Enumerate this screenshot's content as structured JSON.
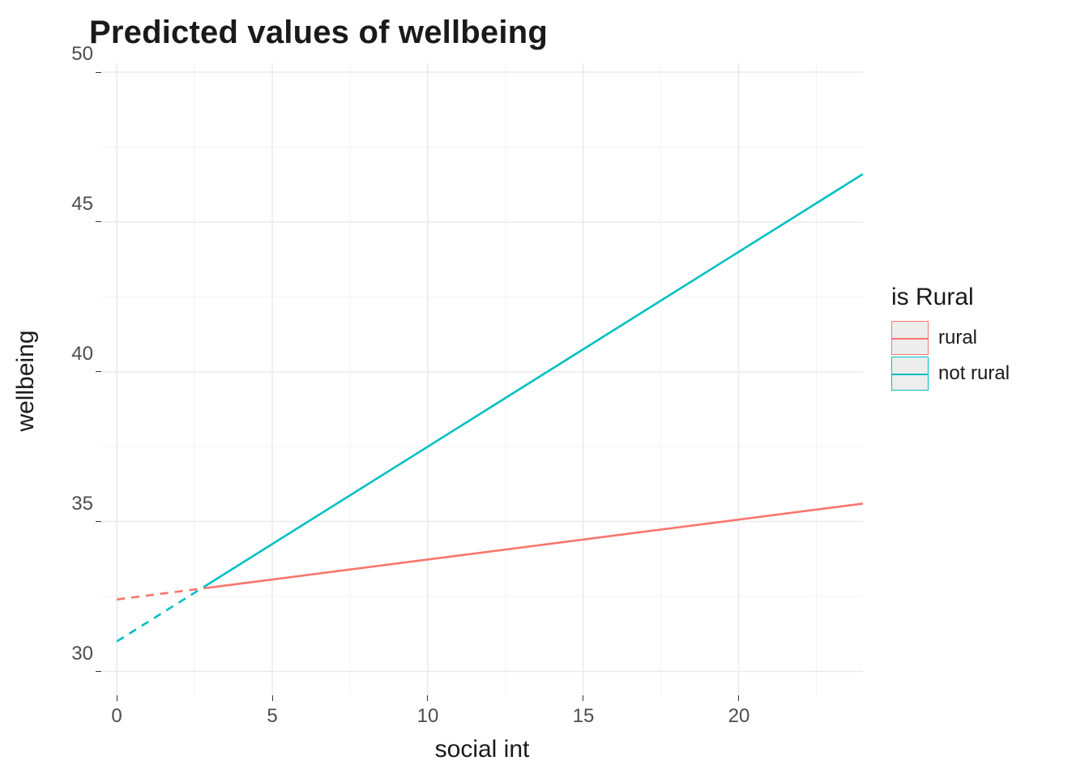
{
  "chart_data": {
    "type": "line",
    "title": "Predicted values of wellbeing",
    "xlabel": "social int",
    "ylabel": "wellbeing",
    "xlim": [
      -0.5,
      24.0
    ],
    "ylim": [
      29.2,
      50.3
    ],
    "x_ticks": [
      0,
      5,
      10,
      15,
      20
    ],
    "y_ticks": [
      30,
      35,
      40,
      45,
      50
    ],
    "legend_title": "is Rural",
    "legend_position": "right",
    "grid": true,
    "colors": {
      "rural": "#F8766D",
      "not rural": "#00BFC4"
    },
    "series": [
      {
        "name": "rural",
        "x_dashed": [
          0,
          3
        ],
        "y_dashed": [
          32.4,
          32.8
        ],
        "x": [
          3,
          24
        ],
        "y": [
          32.8,
          35.6
        ],
        "intercept": 32.4,
        "slope_per_x": 0.1333
      },
      {
        "name": "not rural",
        "x_dashed": [
          0,
          3
        ],
        "y_dashed": [
          31.0,
          32.95
        ],
        "x": [
          3,
          24
        ],
        "y": [
          32.95,
          46.6
        ],
        "intercept": 31.0,
        "slope_per_x": 0.65
      }
    ]
  }
}
